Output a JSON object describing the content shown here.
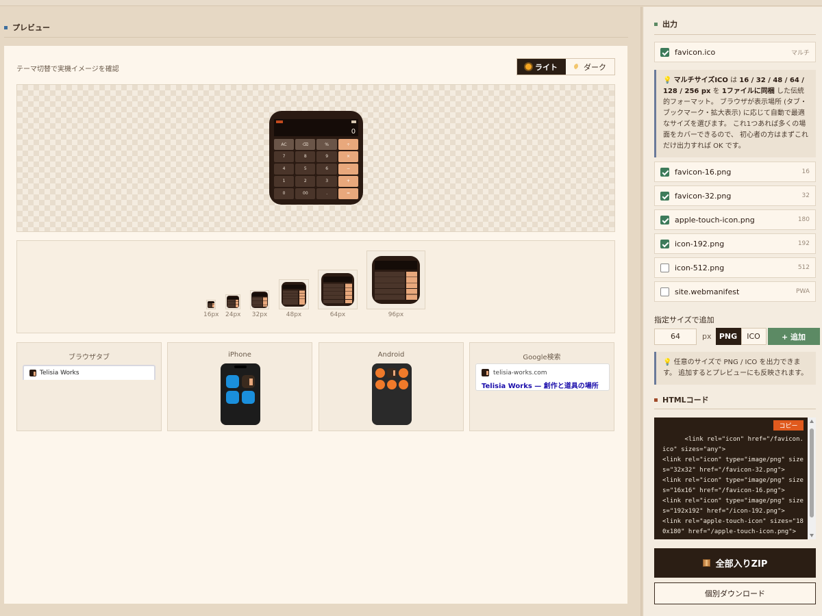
{
  "preview": {
    "section_title": "プレビュー",
    "subtitle": "テーマ切替で実機イメージを確認",
    "theme_light": "ライト",
    "theme_dark": "ダーク",
    "calc": {
      "display": "0",
      "keys": [
        "AC",
        "⌫",
        "%",
        "÷",
        "7",
        "8",
        "9",
        "×",
        "4",
        "5",
        "6",
        "−",
        "1",
        "2",
        "3",
        "+",
        "0",
        "00",
        ".",
        "="
      ]
    },
    "sizes": [
      {
        "label": "16px"
      },
      {
        "label": "24px"
      },
      {
        "label": "32px"
      },
      {
        "label": "48px"
      },
      {
        "label": "64px"
      },
      {
        "label": "96px"
      }
    ],
    "browser_tab": {
      "title": "ブラウザタブ",
      "text": "Telisia Works"
    },
    "iphone": {
      "title": "iPhone"
    },
    "android": {
      "title": "Android"
    },
    "google": {
      "title": "Google検索",
      "domain": "telisia-works.com",
      "result_title": "Telisia Works — 創作と道具の場所"
    }
  },
  "output": {
    "section_title": "出力",
    "files": [
      {
        "name": "favicon.ico",
        "meta": "マルチ",
        "checked": true
      },
      {
        "name": "favicon-16.png",
        "meta": "16",
        "checked": true
      },
      {
        "name": "favicon-32.png",
        "meta": "32",
        "checked": true
      },
      {
        "name": "apple-touch-icon.png",
        "meta": "180",
        "checked": true
      },
      {
        "name": "icon-192.png",
        "meta": "192",
        "checked": true
      },
      {
        "name": "icon-512.png",
        "meta": "512",
        "checked": false
      },
      {
        "name": "site.webmanifest",
        "meta": "PWA",
        "checked": false
      }
    ],
    "ico_info": {
      "bold1": "マルチサイズICO",
      "t1": " は ",
      "bold2": "16 / 32 / 48 / 64 / 128 / 256 px",
      "t2": " を ",
      "bold3": "1ファイルに同梱",
      "t3": " した伝統的フォーマット。 ブラウザが表示場所 (タブ・ブックマーク・拡大表示) に応じて自動で最適なサイズを選びます。 これ1つあれば多くの場面をカバーできるので、 初心者の方はまずこれだけ出力すれば OK です。"
    },
    "custom": {
      "title": "指定サイズで追加",
      "value": "64",
      "unit": "px",
      "fmt_png": "PNG",
      "fmt_ico": "ICO",
      "add": "+ 追加",
      "info": "任意のサイズで PNG / ICO を出力できます。 追加するとプレビューにも反映されます。"
    },
    "html_title": "HTMLコード",
    "copy": "コピー",
    "code": "      <link rel=\"icon\" href=\"/favicon.ico\" sizes=\"any\">\n<link rel=\"icon\" type=\"image/png\" sizes=\"32x32\" href=\"/favicon-32.png\">\n<link rel=\"icon\" type=\"image/png\" sizes=\"16x16\" href=\"/favicon-16.png\">\n<link rel=\"icon\" type=\"image/png\" sizes=\"192x192\" href=\"/icon-192.png\">\n<link rel=\"apple-touch-icon\" sizes=\"180x180\" href=\"/apple-touch-icon.png\">",
    "zip": "全部入りZIP",
    "individual": "個別ダウンロード"
  },
  "colors": {
    "accent_dark": "#2b1e14",
    "accent_green": "#5c8a64",
    "copy_orange": "#e05a1e",
    "check_green": "#3d7b5a"
  }
}
